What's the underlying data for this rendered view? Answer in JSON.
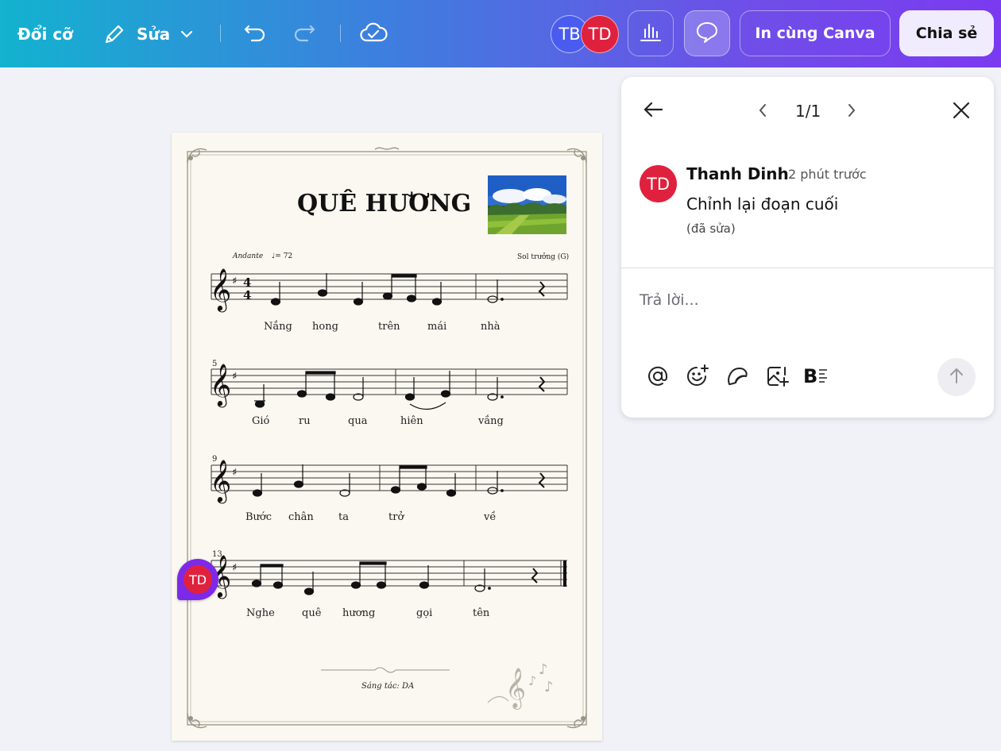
{
  "toolbar": {
    "resize_label": "Đổi cỡ",
    "edit_label": "Sửa",
    "collaborators": [
      {
        "initials": "TB",
        "color": "#4a5cf0"
      },
      {
        "initials": "TD",
        "color": "#e0213e"
      }
    ],
    "print_label": "In cùng Canva",
    "share_label": "Chia sẻ"
  },
  "sheet": {
    "title": "QUÊ HƯƠNG",
    "tempo_label": "Andante",
    "tempo_value": "= 72",
    "key_label": "Sol trưởng (G)",
    "systems": [
      {
        "measure_number": "",
        "lyrics": [
          "Nắng",
          "hong",
          "trên",
          "mái",
          "nhà"
        ]
      },
      {
        "measure_number": "5",
        "lyrics": [
          "Gió",
          "ru",
          "qua",
          "hiên",
          "vắng"
        ]
      },
      {
        "measure_number": "9",
        "lyrics": [
          "Bước",
          "chân",
          "ta",
          "trở",
          "về"
        ]
      },
      {
        "measure_number": "13",
        "lyrics": [
          "Nghe",
          "quê",
          "hương",
          "gọi",
          "tên"
        ]
      }
    ],
    "composer": "Sáng tác: DA",
    "comment_marker_initials": "TD"
  },
  "comment_panel": {
    "pager": "1/1",
    "comment": {
      "author_initials": "TD",
      "author": "Thanh Dinh",
      "time": "2 phút trước",
      "text": "Chỉnh lại đoạn cuối",
      "edited": "(đã sửa)"
    },
    "reply_placeholder": "Trả lời...",
    "bold_list_label": "B"
  },
  "colors": {
    "avatar_red": "#e0213e",
    "avatar_blue": "#4a5cf0",
    "marker_purple": "#7d2ae8"
  }
}
